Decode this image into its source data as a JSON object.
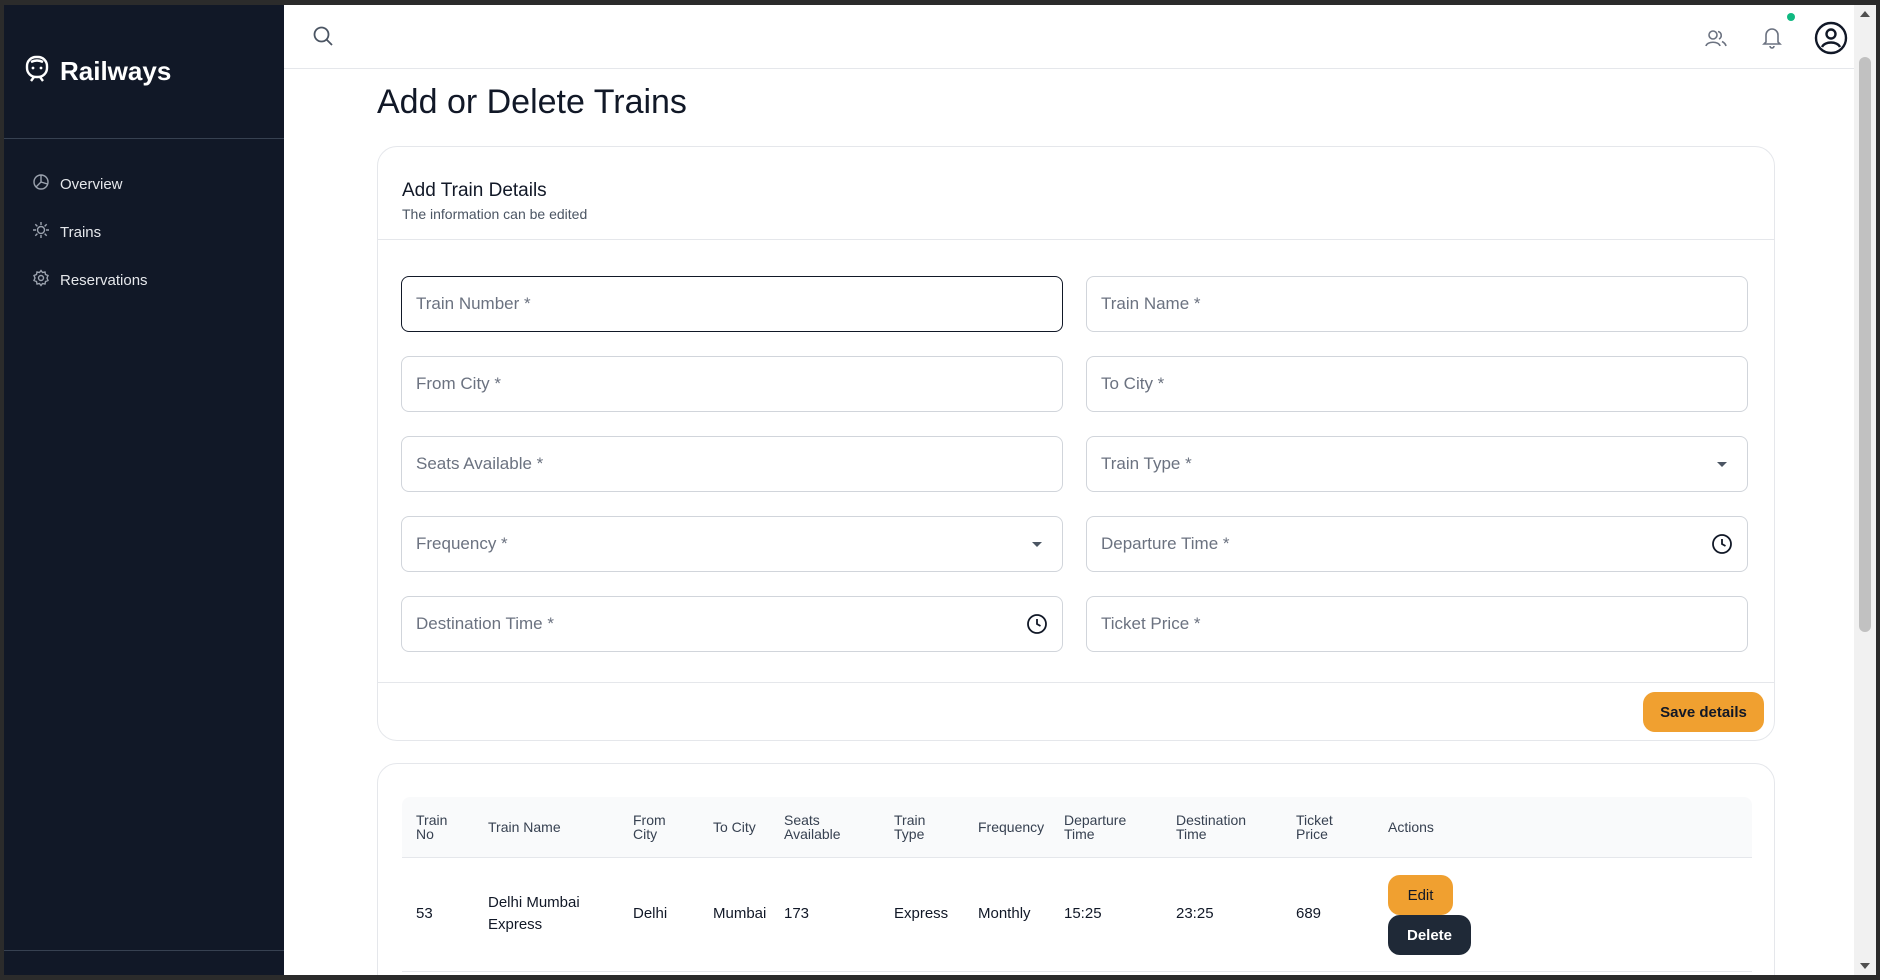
{
  "app": {
    "name": "Railways"
  },
  "sidebar": {
    "items": [
      {
        "label": "Overview",
        "icon": "pie-chart-icon"
      },
      {
        "label": "Trains",
        "icon": "train-icon"
      },
      {
        "label": "Reservations",
        "icon": "gear-icon"
      }
    ]
  },
  "topbar": {
    "icons": [
      "search-icon",
      "users-icon",
      "bell-icon",
      "account-icon"
    ],
    "notification_dot_color": "#10b981"
  },
  "page": {
    "title": "Add or Delete Trains"
  },
  "form": {
    "title": "Add Train Details",
    "subtitle": "The information can be edited",
    "fields": {
      "train_number": "Train Number *",
      "train_name": "Train Name *",
      "from_city": "From City *",
      "to_city": "To City *",
      "seats_available": "Seats Available *",
      "train_type": "Train Type *",
      "frequency": "Frequency *",
      "departure_time": "Departure Time *",
      "destination_time": "Destination Time *",
      "ticket_price": "Ticket Price *"
    },
    "save_label": "Save details",
    "accent_color": "#f0a030"
  },
  "table": {
    "headers": {
      "train_no": [
        "Train",
        "No"
      ],
      "train_name": "Train Name",
      "from_city": [
        "From",
        "City"
      ],
      "to_city": "To City",
      "seats_available": [
        "Seats",
        "Available"
      ],
      "train_type": [
        "Train",
        "Type"
      ],
      "frequency": "Frequency",
      "departure_time": [
        "Departure",
        "Time"
      ],
      "destination_time": [
        "Destination",
        "Time"
      ],
      "ticket_price": [
        "Ticket",
        "Price"
      ],
      "actions": "Actions"
    },
    "rows": [
      {
        "train_no": "53",
        "train_name": [
          "Delhi Mumbai",
          "Express"
        ],
        "from_city": "Delhi",
        "to_city": "Mumbai",
        "seats_available": "173",
        "train_type": "Express",
        "frequency": "Monthly",
        "departure_time": "15:25",
        "destination_time": "23:25",
        "ticket_price": "689",
        "edit_label": "Edit",
        "delete_label": "Delete"
      }
    ]
  }
}
